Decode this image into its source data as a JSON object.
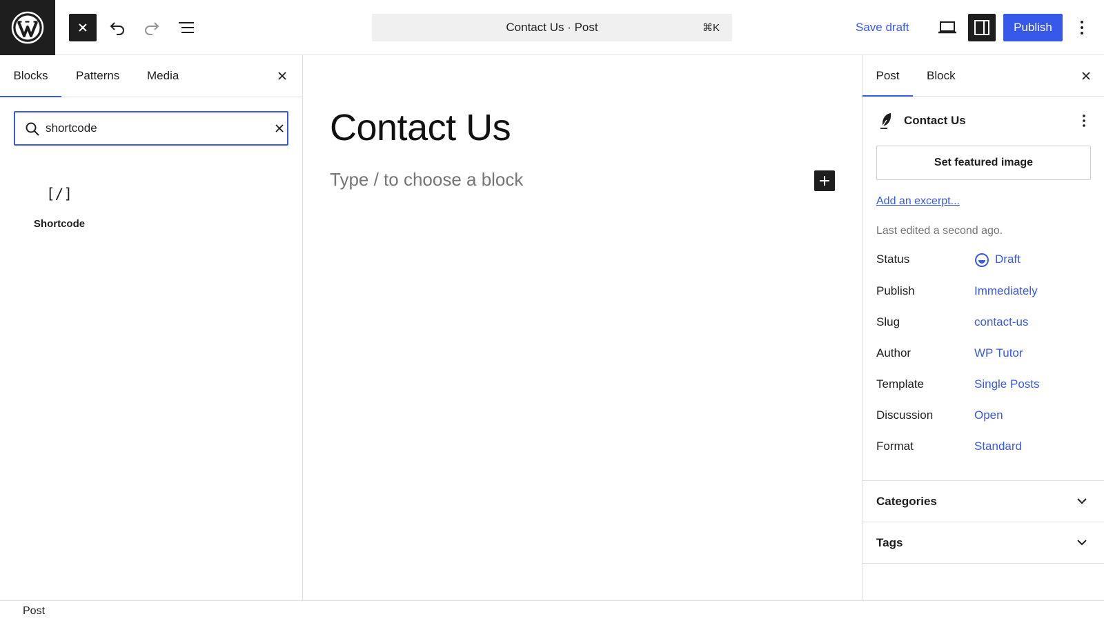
{
  "toolbar": {
    "logo_icon": "wordpress-logo-icon",
    "close_inserter_icon": "close-icon",
    "undo_icon": "undo-icon",
    "redo_icon": "redo-icon",
    "document_overview_icon": "list-view-icon",
    "command_bar": {
      "title": "Contact Us · Post",
      "shortcut": "⌘K"
    },
    "save_draft_label": "Save draft",
    "preview_icon": "desktop-preview-icon",
    "settings_icon": "sidebar-toggle-icon",
    "publish_label": "Publish",
    "more_icon": "vertical-ellipsis-icon"
  },
  "inserter": {
    "tabs": [
      {
        "label": "Blocks",
        "active": true
      },
      {
        "label": "Patterns",
        "active": false
      },
      {
        "label": "Media",
        "active": false
      }
    ],
    "search": {
      "value": "shortcode",
      "placeholder": "Search"
    },
    "results": [
      {
        "icon": "[/]",
        "label": "Shortcode"
      }
    ]
  },
  "canvas": {
    "title": "Contact Us",
    "placeholder": "Type / to choose a block"
  },
  "sidebar": {
    "tabs": [
      {
        "label": "Post",
        "active": true
      },
      {
        "label": "Block",
        "active": false
      }
    ],
    "post_title": "Contact Us",
    "featured_image_label": "Set featured image",
    "excerpt_link": "Add an excerpt...",
    "last_edited": "Last edited a second ago.",
    "meta": [
      {
        "label": "Status",
        "value": "Draft"
      },
      {
        "label": "Publish",
        "value": "Immediately"
      },
      {
        "label": "Slug",
        "value": "contact-us"
      },
      {
        "label": "Author",
        "value": "WP Tutor"
      },
      {
        "label": "Template",
        "value": "Single Posts"
      },
      {
        "label": "Discussion",
        "value": "Open"
      },
      {
        "label": "Format",
        "value": "Standard"
      }
    ],
    "panels": [
      {
        "title": "Categories",
        "expanded": false
      },
      {
        "title": "Tags",
        "expanded": false
      }
    ]
  },
  "footer": {
    "breadcrumb": "Post"
  },
  "colors": {
    "accent": "#3858e9",
    "dark": "#1e1e1e",
    "muted": "#757575",
    "border": "#e0e0e0"
  }
}
